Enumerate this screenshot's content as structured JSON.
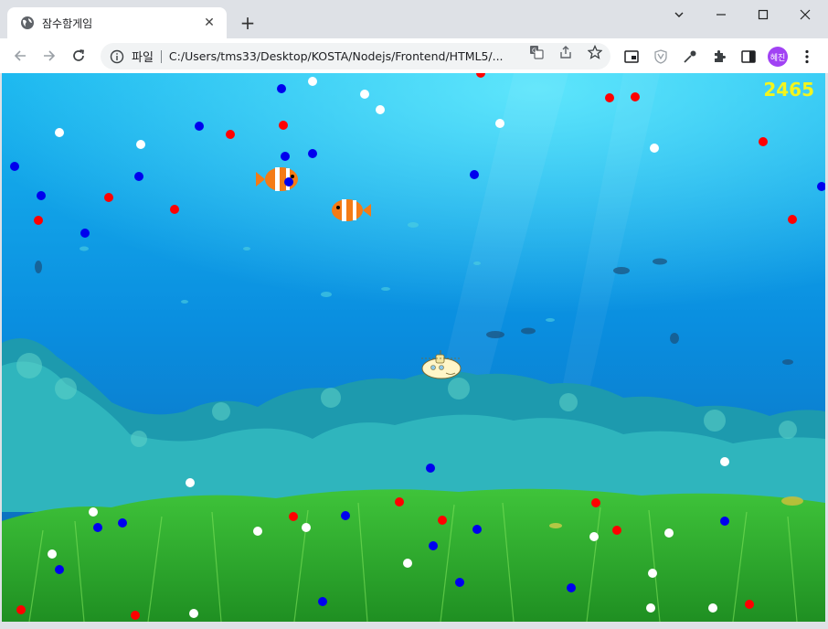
{
  "browser": {
    "tab_title": "잠수함게임",
    "omnibox_scheme": "파일",
    "url": "C:/Users/tms33/Desktop/KOSTA/Nodejs/Frontend/HTML5/...",
    "profile_label": "혜진"
  },
  "game": {
    "score": "2465",
    "dot_colors": {
      "red": "#ff0000",
      "blue": "#0000ee",
      "white": "#ffffff"
    },
    "dots": [
      [
        "blue",
        308,
        97
      ],
      [
        "white",
        342,
        89
      ],
      [
        "white",
        399,
        103
      ],
      [
        "white",
        416,
        120
      ],
      [
        "red",
        526,
        80
      ],
      [
        "red",
        667,
        107
      ],
      [
        "red",
        695,
        106
      ],
      [
        "white",
        65,
        145
      ],
      [
        "blue",
        218,
        138
      ],
      [
        "red",
        252,
        147
      ],
      [
        "red",
        310,
        137
      ],
      [
        "white",
        154,
        158
      ],
      [
        "white",
        547,
        135
      ],
      [
        "white",
        716,
        162
      ],
      [
        "red",
        835,
        155
      ],
      [
        "blue",
        16,
        182
      ],
      [
        "blue",
        312,
        171
      ],
      [
        "blue",
        342,
        168
      ],
      [
        "blue",
        152,
        193
      ],
      [
        "blue",
        519,
        191
      ],
      [
        "blue",
        316,
        199
      ],
      [
        "blue",
        899,
        204
      ],
      [
        "blue",
        45,
        214
      ],
      [
        "red",
        119,
        216
      ],
      [
        "red",
        191,
        229
      ],
      [
        "red",
        42,
        241
      ],
      [
        "blue",
        93,
        255
      ],
      [
        "red",
        867,
        240
      ],
      [
        "white",
        208,
        528
      ],
      [
        "blue",
        471,
        512
      ],
      [
        "white",
        793,
        505
      ],
      [
        "white",
        102,
        560
      ],
      [
        "red",
        437,
        549
      ],
      [
        "red",
        652,
        550
      ],
      [
        "red",
        321,
        565
      ],
      [
        "blue",
        378,
        564
      ],
      [
        "red",
        484,
        569
      ],
      [
        "blue",
        134,
        572
      ],
      [
        "blue",
        107,
        577
      ],
      [
        "white",
        335,
        577
      ],
      [
        "white",
        282,
        581
      ],
      [
        "blue",
        522,
        579
      ],
      [
        "red",
        675,
        580
      ],
      [
        "white",
        650,
        587
      ],
      [
        "white",
        732,
        583
      ],
      [
        "blue",
        793,
        570
      ],
      [
        "blue",
        474,
        597
      ],
      [
        "white",
        57,
        606
      ],
      [
        "white",
        446,
        616
      ],
      [
        "blue",
        65,
        623
      ],
      [
        "white",
        714,
        627
      ],
      [
        "blue",
        503,
        637
      ],
      [
        "blue",
        625,
        643
      ],
      [
        "blue",
        353,
        658
      ],
      [
        "red",
        23,
        667
      ],
      [
        "red",
        148,
        673
      ],
      [
        "white",
        212,
        671
      ],
      [
        "white",
        712,
        665
      ],
      [
        "white",
        780,
        665
      ],
      [
        "red",
        820,
        661
      ]
    ]
  }
}
